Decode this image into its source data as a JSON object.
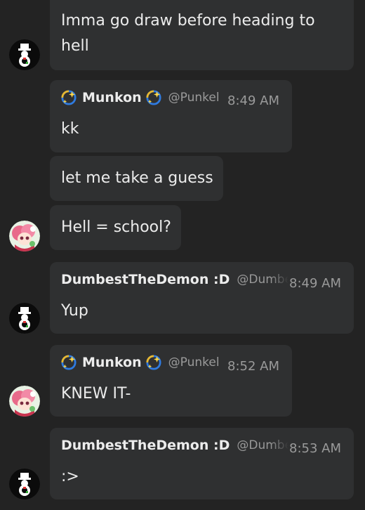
{
  "messages": [
    {
      "text_line1": "Imma go draw before heading to",
      "text_line2": "hell"
    },
    {
      "author": "Munkon",
      "handle": "@Punkel",
      "time": "8:49 AM",
      "text": "kk"
    },
    {
      "text": "let me take a guess"
    },
    {
      "text": "Hell = school?"
    },
    {
      "author": "DumbestTheDemon :D",
      "handle": "@Dumbe",
      "time": "8:49 AM",
      "text": "Yup"
    },
    {
      "author": "Munkon",
      "handle": "@Punkel",
      "time": "8:52 AM",
      "text": "KNEW IT-"
    },
    {
      "author": "DumbestTheDemon :D",
      "handle": "@Dumbe",
      "time": "8:53 AM",
      "text": ":>"
    }
  ],
  "icons": {
    "sparkle": "sparkle-emoji-icon",
    "avatar_a": "black-white-snowman-avatar",
    "avatar_b": "pink-anime-avatar"
  },
  "colors": {
    "background": "#232323",
    "bubble": "#2f3031",
    "text": "#ececec",
    "muted": "#9a9a9a"
  }
}
